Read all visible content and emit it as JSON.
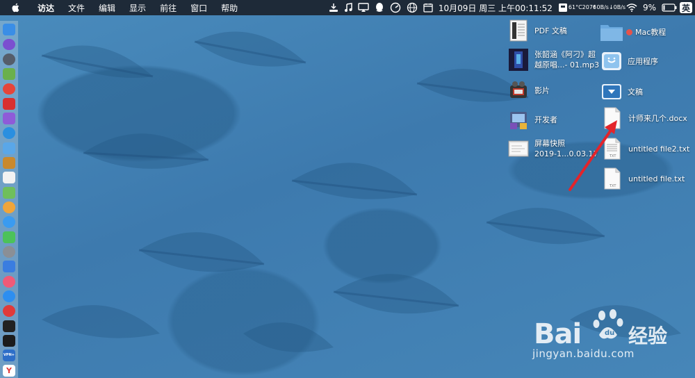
{
  "menubar": {
    "app_name": "访达",
    "menus": [
      "文件",
      "编辑",
      "显示",
      "前往",
      "窗口",
      "帮助"
    ],
    "status": {
      "clock": "10月09日 周三 上午00:11:52",
      "temp_top": "61°C",
      "temp_bottom": "2076",
      "net_up": "↑0B/s",
      "net_down": "↓0B/s",
      "battery": "9%",
      "input_method": "英"
    }
  },
  "desktop": {
    "items": [
      {
        "name": "pdf-document",
        "label": "PDF 文稿",
        "label2": ""
      },
      {
        "name": "mac-tutorial-folder",
        "label": "Mac教程",
        "label2": ""
      },
      {
        "name": "mp3-file",
        "label": "张韶涵《阿刁》超",
        "label2": "越原唱...- 01.mp3"
      },
      {
        "name": "applications-folder",
        "label": "应用程序",
        "label2": ""
      },
      {
        "name": "movies-folder",
        "label": "影片",
        "label2": ""
      },
      {
        "name": "documents-folder",
        "label": "文稿",
        "label2": ""
      },
      {
        "name": "developer-folder",
        "label": "开发者",
        "label2": ""
      },
      {
        "name": "docx-file",
        "label": "计师来几个.docx",
        "label2": ""
      },
      {
        "name": "screenshot-file",
        "label": "屏幕快照",
        "label2": "2019-1...0.03.17"
      },
      {
        "name": "untitled-file2-txt",
        "label": "untitled file2.txt",
        "label2": ""
      },
      {
        "name": "untitled-file-txt",
        "label": "untitled file.txt",
        "label2": ""
      }
    ]
  },
  "dock": {
    "apps": [
      {
        "name": "finder-icon",
        "color": "#3a8ee6"
      },
      {
        "name": "siri-icon",
        "color": "#7b4fd0"
      },
      {
        "name": "launchpad-icon",
        "color": "#555d6a"
      },
      {
        "name": "android-file-icon",
        "color": "#6ab04c"
      },
      {
        "name": "chrome-icon",
        "color": "#e6453a"
      },
      {
        "name": "netease-icon",
        "color": "#d8302f"
      },
      {
        "name": "notes-purple-icon",
        "color": "#8e5bd8"
      },
      {
        "name": "safari-icon",
        "color": "#2a8fe0"
      },
      {
        "name": "preview-icon",
        "color": "#5aa7e8"
      },
      {
        "name": "book-icon",
        "color": "#c9892e"
      },
      {
        "name": "calendar-icon",
        "color": "#f2f2f2"
      },
      {
        "name": "map-icon",
        "color": "#6fbf5c"
      },
      {
        "name": "photos-icon",
        "color": "#f0a53a"
      },
      {
        "name": "messages-icon",
        "color": "#3a9bf0"
      },
      {
        "name": "facetime-icon",
        "color": "#4cc25a"
      },
      {
        "name": "system-prefs-icon",
        "color": "#8a8f96"
      },
      {
        "name": "keynote-icon",
        "color": "#3a7de0"
      },
      {
        "name": "music-icon",
        "color": "#f05a78"
      },
      {
        "name": "app-store-icon",
        "color": "#2d8ef0"
      },
      {
        "name": "vivaldi-icon",
        "color": "#e03a3a"
      },
      {
        "name": "terminal-icon",
        "color": "#222222"
      },
      {
        "name": "activity-monitor-icon",
        "color": "#1c1c1c"
      },
      {
        "name": "vpn-icon",
        "color": "#2d6ec8",
        "label": "VPN+"
      },
      {
        "name": "yandex-icon",
        "color": "#ffffff",
        "label": "Y"
      }
    ]
  },
  "watermark": {
    "brand": "Bai",
    "brand2": "经验",
    "url": "jingyan.baidu.com"
  }
}
